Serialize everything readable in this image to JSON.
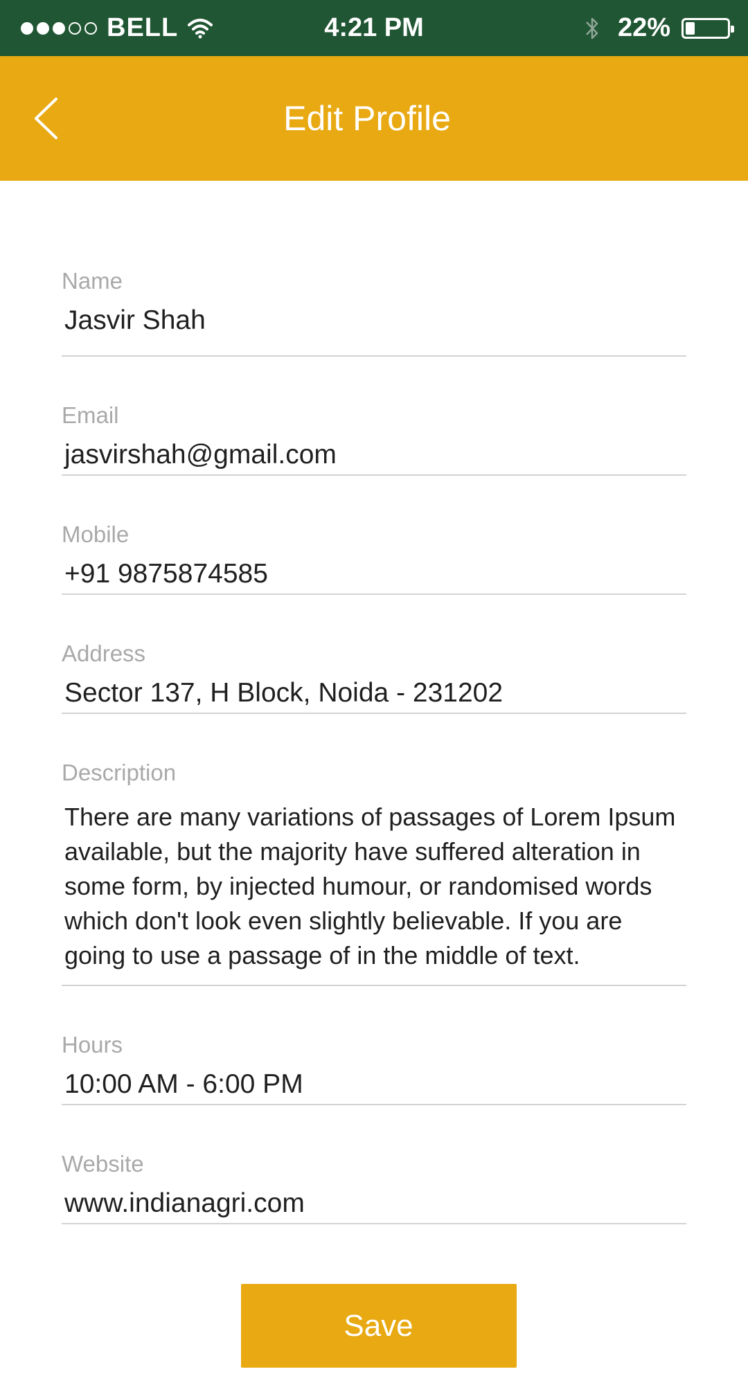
{
  "status_bar": {
    "carrier": "BELL",
    "time": "4:21 PM",
    "battery_percent": "22%",
    "battery_level": 0.22,
    "signal_bars_filled": 3,
    "signal_bars_total": 5,
    "icons": [
      "wifi-icon",
      "bluetooth-icon",
      "battery-icon"
    ]
  },
  "header": {
    "title": "Edit Profile",
    "back_icon": "chevron-left-icon",
    "background": "#e8a912"
  },
  "form": {
    "fields": [
      {
        "label": "Name",
        "value": "Jasvir Shah"
      },
      {
        "label": "Email",
        "value": "jasvirshah@gmail.com"
      },
      {
        "label": "Mobile",
        "value": "+91 9875874585"
      },
      {
        "label": "Address",
        "value": "Sector 137, H Block, Noida - 231202"
      },
      {
        "label": "Description",
        "value": "There are many variations of passages of Lorem Ipsum available, but the majority have suffered alteration in some form, by injected humour, or randomised words which don't look even slightly believable. If you are going to use a passage of in the middle of text."
      },
      {
        "label": "Hours",
        "value": "10:00 AM - 6:00 PM"
      },
      {
        "label": "Website",
        "value": "www.indianagri.com"
      }
    ]
  },
  "actions": {
    "save_label": "Save",
    "accent_color": "#e8a912"
  },
  "colors": {
    "status_bar": "#215634",
    "accent": "#e8a912"
  }
}
